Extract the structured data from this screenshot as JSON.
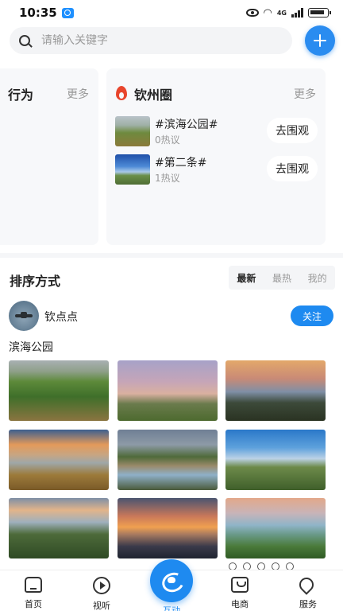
{
  "status_bar": {
    "time": "10:35",
    "network": "4G"
  },
  "search": {
    "placeholder": "请输入关键字"
  },
  "cards": {
    "left": {
      "title": "行为",
      "more": "更多"
    },
    "right": {
      "title": "钦州圈",
      "more": "更多",
      "topics": [
        {
          "name": "#滨海公园#",
          "count": "0热议",
          "button": "去围观"
        },
        {
          "name": "#第二条#",
          "count": "1热议",
          "button": "去围观"
        }
      ]
    }
  },
  "sort": {
    "title": "排序方式",
    "tabs": [
      {
        "label": "最新",
        "active": true
      },
      {
        "label": "最热",
        "active": false
      },
      {
        "label": "我的",
        "active": false
      }
    ]
  },
  "post": {
    "author": "钦点点",
    "follow_label": "关注",
    "title": "滨海公园"
  },
  "colors": {
    "accent": "#1e8af0",
    "flame": "#e8452c"
  },
  "bottom_nav": [
    {
      "label": "首页",
      "icon": "home-icon"
    },
    {
      "label": "视听",
      "icon": "video-play-icon"
    },
    {
      "label": "互动",
      "icon": "interact-icon",
      "active": true
    },
    {
      "label": "电商",
      "icon": "shopping-bag-icon"
    },
    {
      "label": "服务",
      "icon": "service-icon"
    }
  ]
}
